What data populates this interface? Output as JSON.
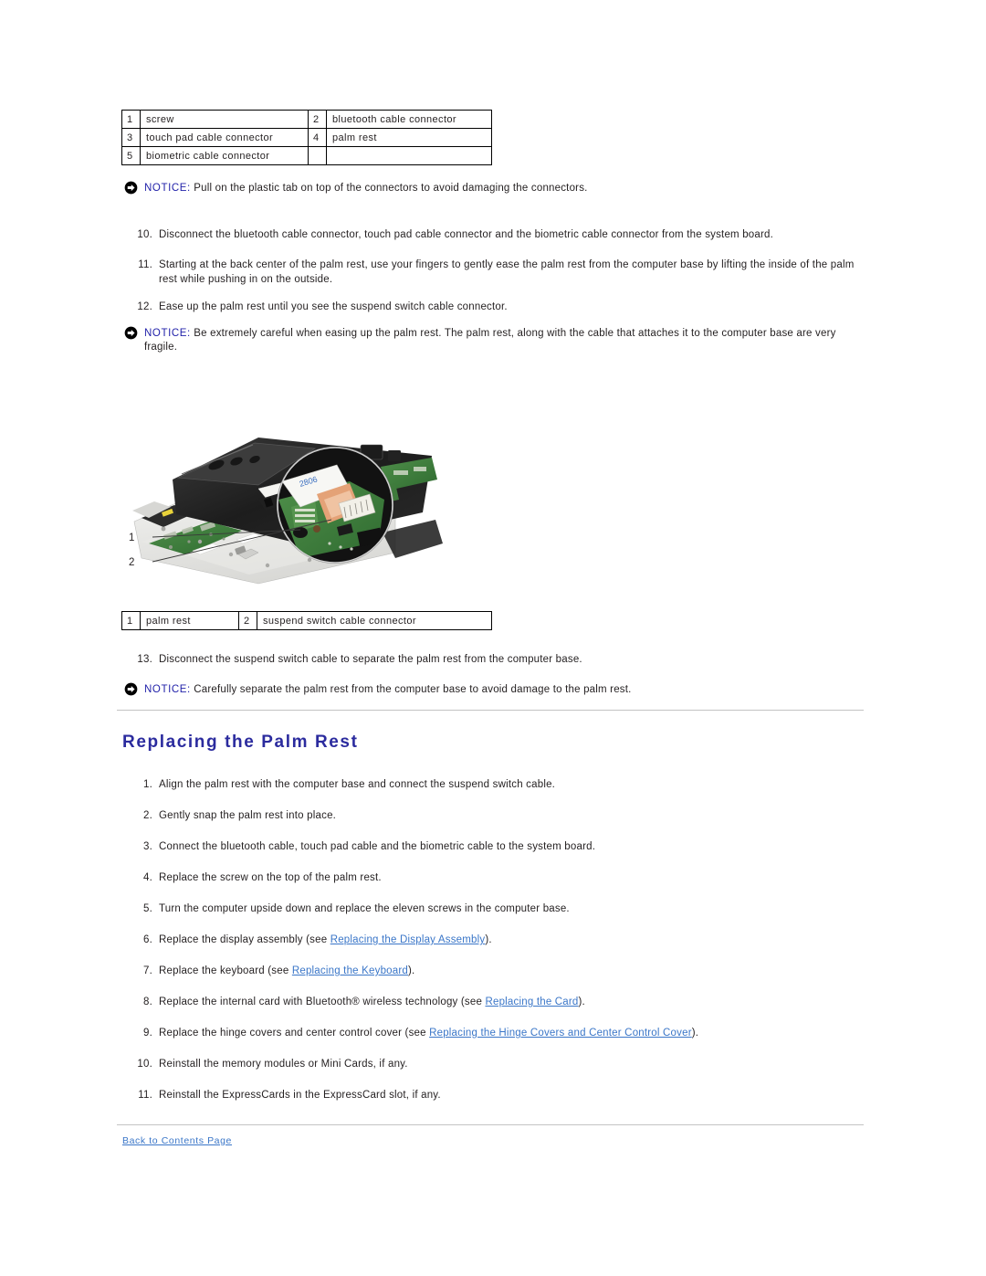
{
  "tables": {
    "components": {
      "name": "palm-rest-components",
      "rows": [
        [
          {
            "num": "1",
            "label": "screw"
          },
          {
            "num": "2",
            "label": "bluetooth cable connector"
          }
        ],
        [
          {
            "num": "3",
            "label": "touch pad cable connector"
          },
          {
            "num": "4",
            "label": "palm rest"
          }
        ],
        [
          {
            "num": "5",
            "label": "biometric cable connector"
          },
          {
            "num": "",
            "label": ""
          }
        ]
      ]
    },
    "palmrest": {
      "name": "palm-rest-figure-legend",
      "rows": [
        [
          {
            "num": "1",
            "label": "palm rest"
          },
          {
            "num": "2",
            "label": "suspend switch cable connector"
          }
        ]
      ]
    }
  },
  "notices": {
    "label": "NOTICE:",
    "connectors": " Pull on the plastic tab on top of the connectors to avoid damaging the connectors.",
    "fragile": " Be extremely careful when easing up the palm rest. The palm rest, along with the cable that attaches it to the computer base are very fragile.",
    "separate": " Carefully separate the palm rest from the computer base to avoid damage to the palm rest."
  },
  "removal_steps": {
    "step10": {
      "num": "10.",
      "text": "Disconnect the bluetooth cable connector, touch pad cable connector and the biometric cable connector from the system board."
    },
    "step11": {
      "num": "11.",
      "text": "Starting at the back center of the palm rest, use your fingers to gently ease the palm rest from the computer base by lifting the inside of the palm rest while pushing in on the outside."
    },
    "step12": {
      "num": "12.",
      "text": "Ease up the palm rest until you see the suspend switch cable connector."
    },
    "step13": {
      "num": "13.",
      "text": "Disconnect the suspend switch cable to separate the palm rest from the computer base."
    }
  },
  "figure": {
    "callout_1": "1",
    "callout_2": "2"
  },
  "heading": "Replacing the Palm Rest",
  "replacing_steps": [
    {
      "num": "1.",
      "pre": "Align the palm rest with the computer base and connect the suspend switch cable.",
      "link": "",
      "post": ""
    },
    {
      "num": "2.",
      "pre": "Gently snap the palm rest into place.",
      "link": "",
      "post": ""
    },
    {
      "num": "3.",
      "pre": "Connect the bluetooth cable, touch pad cable and the biometric cable to the system board.",
      "link": "",
      "post": ""
    },
    {
      "num": "4.",
      "pre": "Replace the screw on the top of the palm rest.",
      "link": "",
      "post": ""
    },
    {
      "num": "5.",
      "pre": "Turn the computer upside down and replace the eleven screws in the computer base.",
      "link": "",
      "post": ""
    },
    {
      "num": "6.",
      "pre": "Replace the display assembly (see ",
      "link": "Replacing the Display Assembly",
      "post": ")."
    },
    {
      "num": "7.",
      "pre": "Replace the keyboard (see ",
      "link": "Replacing the Keyboard",
      "post": ")."
    },
    {
      "num": "8.",
      "pre": "Replace the internal card with Bluetooth® wireless technology (see ",
      "link": "Replacing the Card",
      "post": ")."
    },
    {
      "num": "9.",
      "pre": "Replace the hinge covers and center control cover (see ",
      "link": "Replacing the Hinge Covers and Center Control Cover",
      "post": ")."
    },
    {
      "num": "10.",
      "pre": "Reinstall the memory modules or Mini Cards, if any.",
      "link": "",
      "post": ""
    },
    {
      "num": "11.",
      "pre": "Reinstall the ExpressCards in the ExpressCard slot, if any.",
      "link": "",
      "post": ""
    }
  ],
  "footer": {
    "back_link": "Back to Contents Page"
  },
  "colors": {
    "heading": "#2b2b9e",
    "link": "#3a76c8",
    "notice_label": "#2222aa",
    "rule": "#c3c3c3"
  }
}
